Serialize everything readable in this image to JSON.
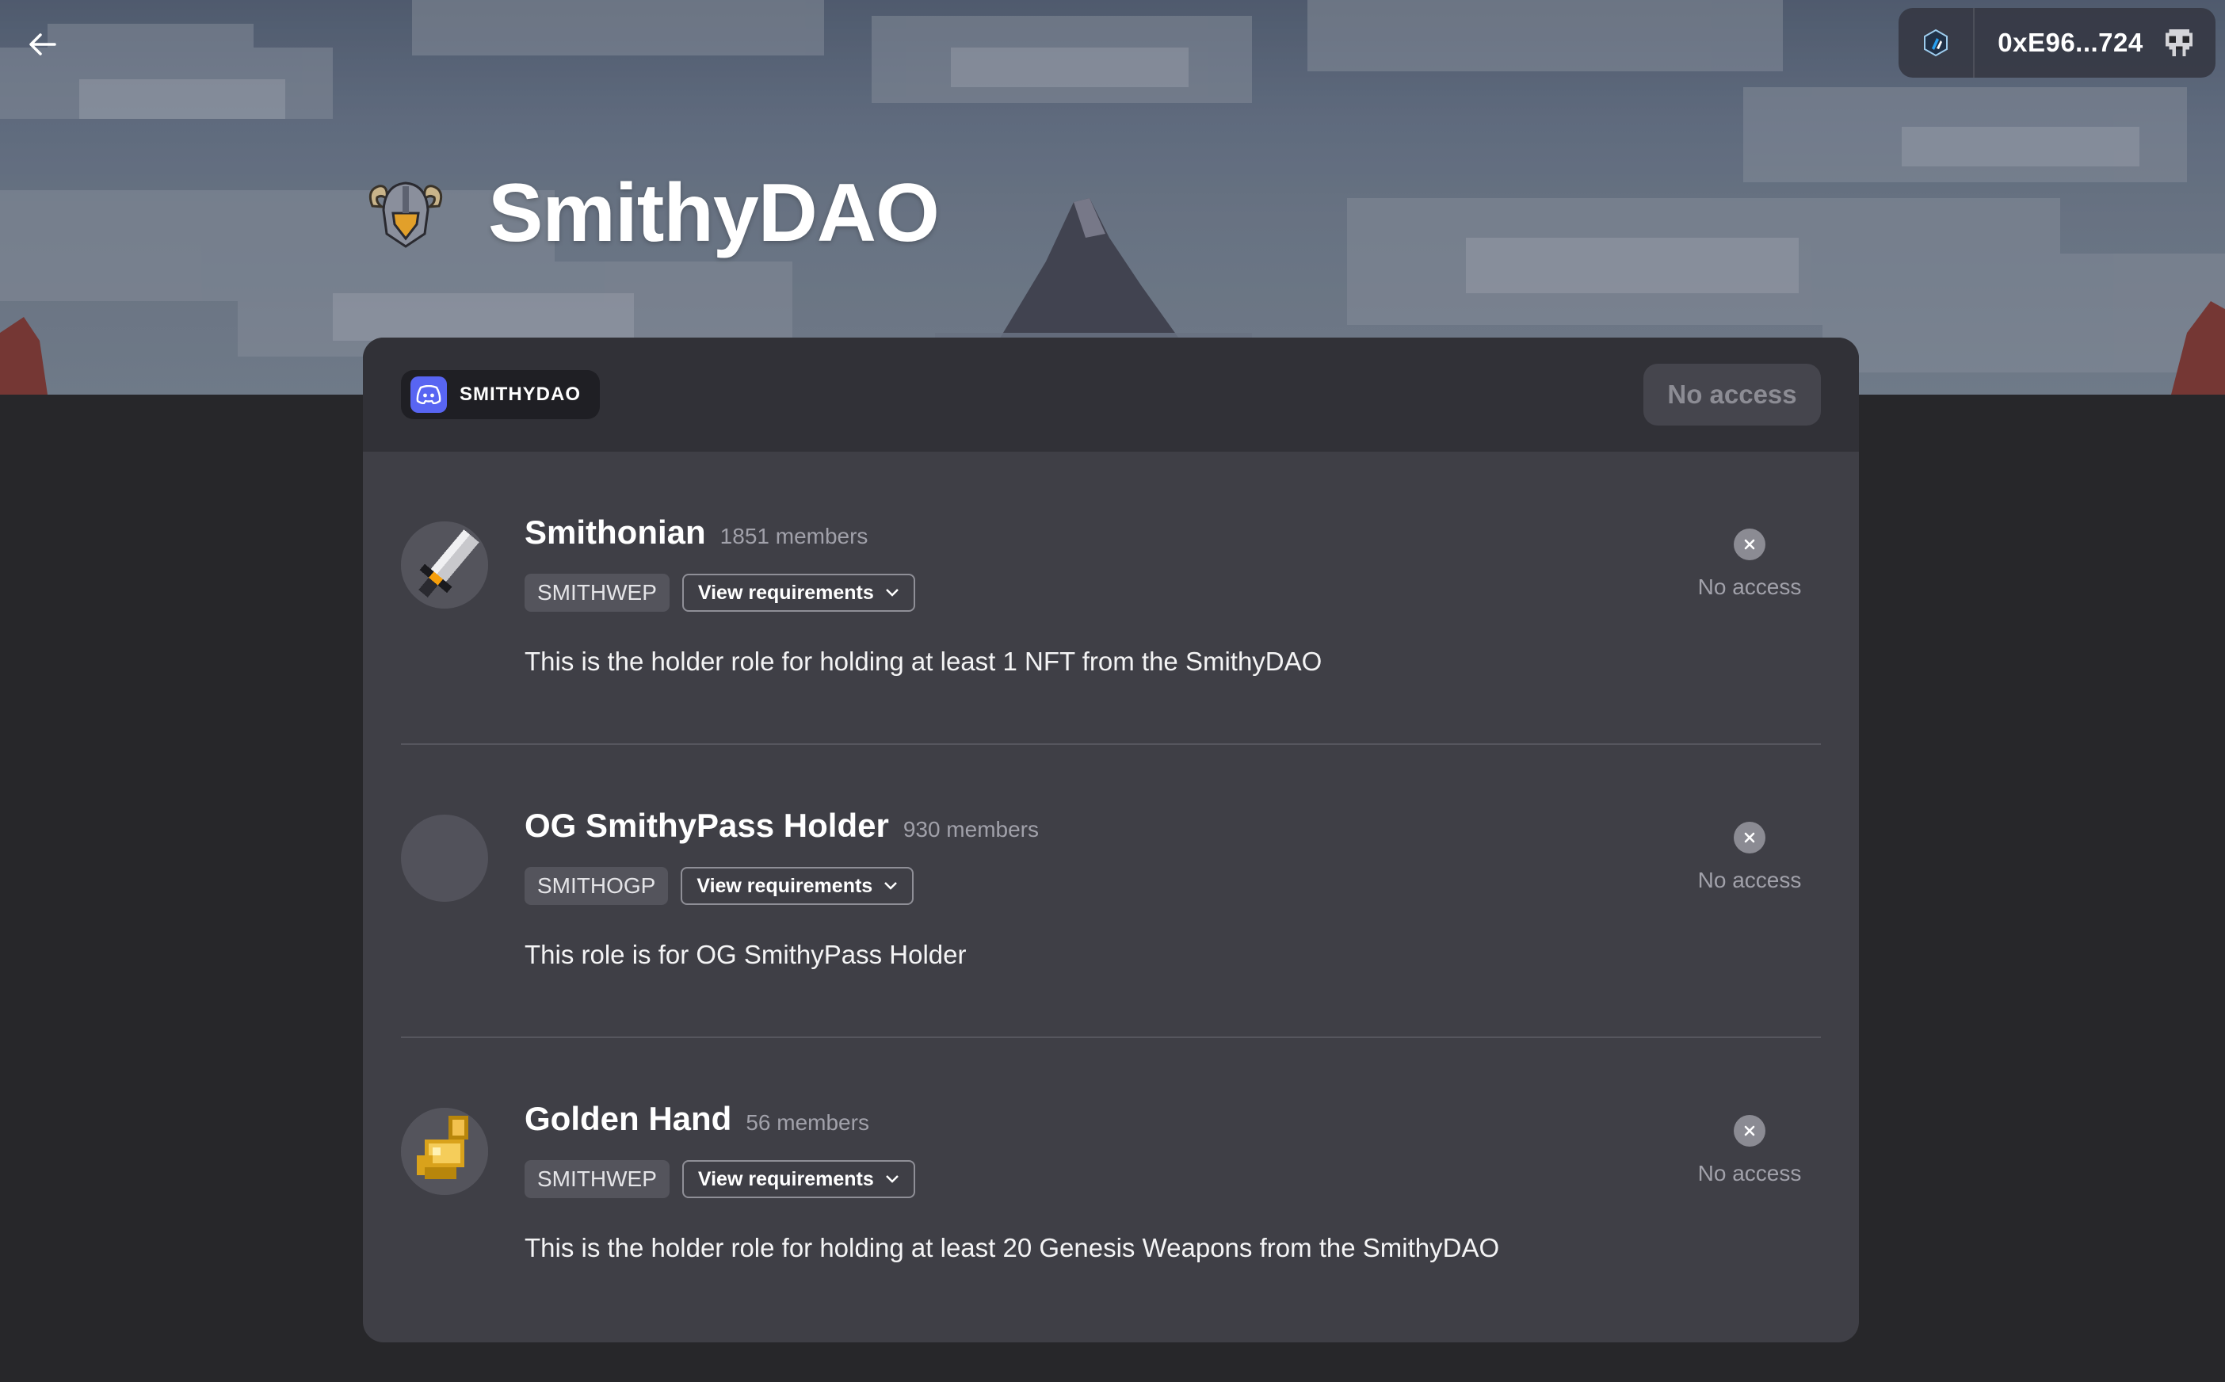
{
  "header": {
    "back_icon": "arrow-left-icon",
    "wallet": {
      "network_icon": "arbitrum-icon",
      "address": "0xE96...724",
      "avatar_icon": "pixel-avatar-icon"
    }
  },
  "guild": {
    "name": "SmithyDAO",
    "logo_icon": "horned-helmet-icon"
  },
  "card": {
    "platform": {
      "icon": "discord-icon",
      "label": "SMITHYDAO"
    },
    "access_label": "No access"
  },
  "roles": [
    {
      "name": "Smithonian",
      "members": "1851 members",
      "token": "SMITHWEP",
      "requirements_label": "View requirements",
      "description": "This is the holder role for holding at least 1 NFT from the SmithyDAO",
      "status": "No access",
      "image_icon": "sword-icon"
    },
    {
      "name": "OG SmithyPass Holder",
      "members": "930 members",
      "token": "SMITHOGP",
      "requirements_label": "View requirements",
      "description": "This role is for OG SmithyPass Holder",
      "status": "No access",
      "image_icon": "empty-avatar-icon"
    },
    {
      "name": "Golden Hand",
      "members": "56 members",
      "token": "SMITHWEP",
      "requirements_label": "View requirements",
      "description": "This is the holder role for holding at least 20 Genesis Weapons from the SmithyDAO",
      "status": "No access",
      "image_icon": "golden-gauntlet-icon"
    }
  ],
  "colors": {
    "page_bg": "#27272a",
    "card_bg": "#3f3f46",
    "card_header_bg": "#313137",
    "discord": "#5865f2"
  }
}
